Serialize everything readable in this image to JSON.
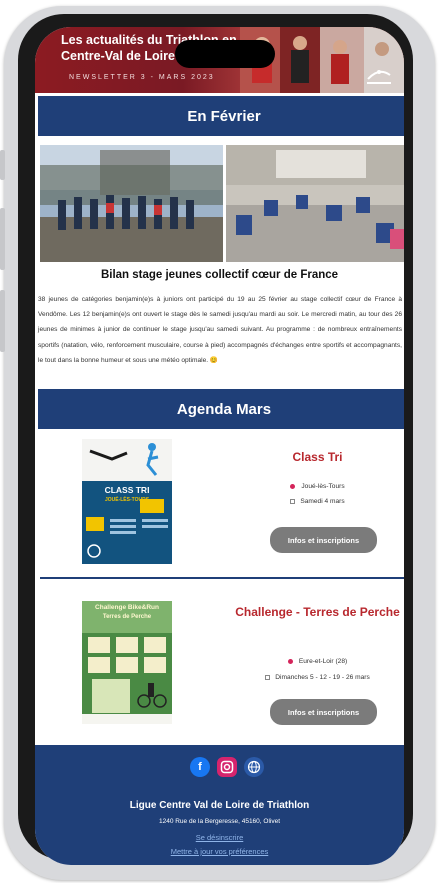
{
  "banner": {
    "title": "Les actualités du Triathlon en Centre-Val de Loire",
    "subtitle": "NEWSLETTER 3 - MARS 2023"
  },
  "sections": {
    "february": "En Février",
    "agenda": "Agenda Mars"
  },
  "feature": {
    "caption": "Bilan stage jeunes collectif cœur de France",
    "paragraph": "38 jeunes de catégories benjamin(e)s à juniors ont participé du 19 au 25 février au stage collectif cœur de France à Vendôme. Les 12 benjamin(e)s ont ouvert le stage dès le samedi jusqu'au mardi au soir. Le mercredi matin, au tour des 26 jeunes de minimes à junior de continuer le stage jusqu'au samedi suivant. Au programme : de nombreux entraînements sportifs (natation, vélo, renforcement musculaire, course à pied) accompagnés d'échanges entre sportifs et accompagnants, le tout dans la bonne humeur et sous une météo optimale. 😊"
  },
  "events": [
    {
      "title": "Class Tri",
      "location": "Joué-lès-Tours",
      "date": "Samedi 4 mars",
      "button": "Infos et inscriptions",
      "poster_title": "CLASS TRI",
      "poster_sub": "JOUÉ-LÈS-TOURS"
    },
    {
      "title": "Challenge - Terres de Perche",
      "location": "Eure-et-Loir (28)",
      "date": "Dimanches 5 - 12 - 19 - 26 mars",
      "button": "Infos et inscriptions",
      "poster_title": "Challenge Bike&Run",
      "poster_sub": "Terres de Perche"
    }
  ],
  "footer": {
    "org": "Ligue Centre Val de Loire de Triathlon",
    "address": "1240 Rue de la Bergeresse, 45160, Olivet",
    "unsubscribe": "Se désinscrire",
    "preferences": "Mettre à jour vos préférences"
  },
  "colors": {
    "navy": "#1f3f78",
    "accent_red": "#b8282e",
    "button_gray": "#7b7b7b"
  }
}
